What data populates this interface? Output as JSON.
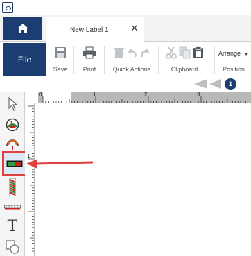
{
  "window": {
    "icon": "app-logo-icon"
  },
  "home": {
    "icon": "home-icon"
  },
  "tab": {
    "label": "New Label 1",
    "close_glyph": "✕"
  },
  "ribbon": {
    "file_label": "File",
    "save_label": "Save",
    "print_label": "Print",
    "quick_actions_label": "Quick Actions",
    "clipboard_label": "Clipboard",
    "arrange_label": "Arrange",
    "position_label": "Position"
  },
  "nav": {
    "page_number": "1"
  },
  "ruler": {
    "marks": [
      "0",
      "1",
      "2",
      "3"
    ],
    "vmark": "1"
  },
  "tools": [
    {
      "name": "pointer-tool-icon"
    },
    {
      "name": "dial-gauge-tool-icon"
    },
    {
      "name": "arc-gauge-tool-icon"
    },
    {
      "name": "linear-bar-tool-icon",
      "selected": true
    },
    {
      "name": "barcode-pole-tool-icon"
    },
    {
      "name": "ruler-line-tool-icon"
    },
    {
      "name": "text-tool-icon",
      "glyph": "T"
    },
    {
      "name": "shape-tool-icon"
    }
  ],
  "colors": {
    "brand": "#1b3d72",
    "highlight": "#e04040",
    "ruler": "#b8b8b8"
  }
}
